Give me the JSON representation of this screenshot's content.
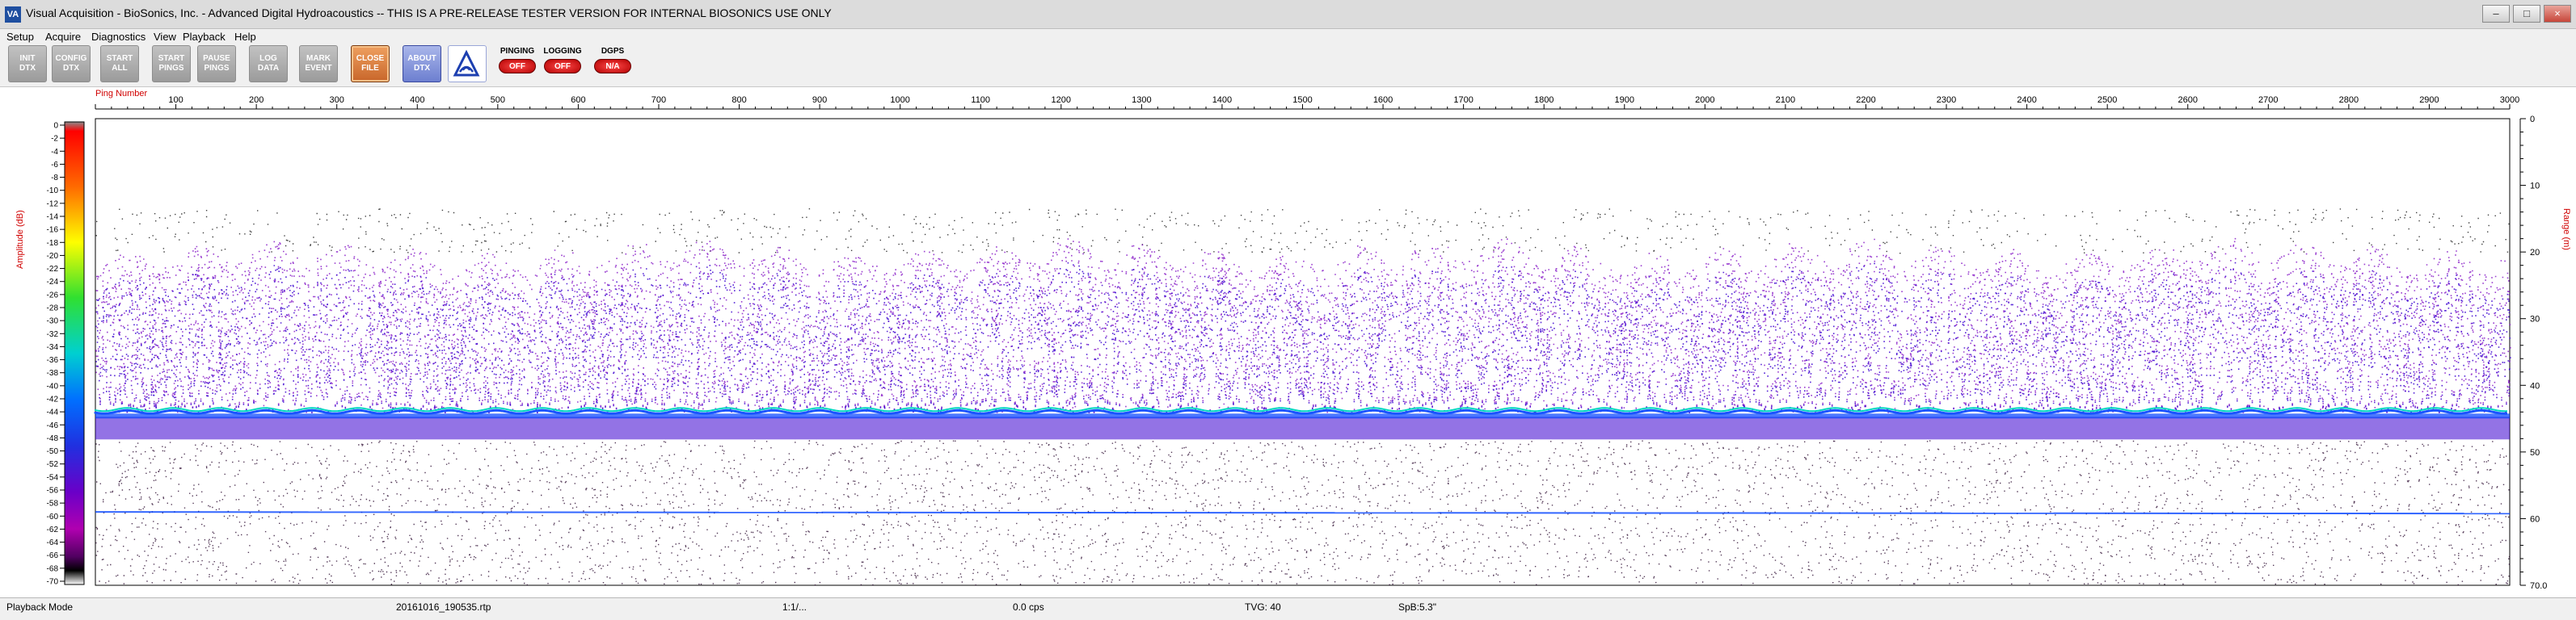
{
  "window": {
    "title": "Visual Acquisition  -  BioSonics, Inc.  -  Advanced Digital Hydroacoustics   -- THIS IS A PRE-RELEASE TESTER VERSION FOR INTERNAL BIOSONICS USE ONLY",
    "icon_text": "VA",
    "minimize": "–",
    "maximize": "□",
    "close": "×"
  },
  "menu": [
    "Setup",
    "Acquire",
    "Diagnostics",
    "View",
    "Playback",
    "Help"
  ],
  "toolbar": {
    "buttons": [
      {
        "line1": "INIT",
        "line2": "DTX",
        "style": "gray"
      },
      {
        "line1": "CONFIG",
        "line2": "DTX",
        "style": "gray"
      },
      {
        "line1": "START",
        "line2": "ALL",
        "style": "gray"
      },
      {
        "line1": "START",
        "line2": "PINGS",
        "style": "gray"
      },
      {
        "line1": "PAUSE",
        "line2": "PINGS",
        "style": "gray"
      },
      {
        "line1": "LOG",
        "line2": "DATA",
        "style": "gray"
      },
      {
        "line1": "MARK",
        "line2": "EVENT",
        "style": "gray"
      },
      {
        "line1": "CLOSE",
        "line2": "FILE",
        "style": "orange"
      },
      {
        "line1": "ABOUT",
        "line2": "DTX",
        "style": "blue"
      }
    ],
    "indicators": [
      {
        "label": "PINGING",
        "value": "OFF"
      },
      {
        "label": "LOGGING",
        "value": "OFF"
      },
      {
        "label": "DGPS",
        "value": "N/A"
      }
    ]
  },
  "echogram": {
    "top_axis_label": "Ping Number",
    "left_axis_label": "Amplitude (dB)",
    "right_axis_label": "Range (m)",
    "ping_ticks": [
      100,
      200,
      300,
      400,
      500,
      600,
      700,
      800,
      900,
      1000,
      1100,
      1200,
      1300,
      1400,
      1500,
      1600,
      1700,
      1800,
      1900,
      2000,
      2100,
      2200,
      2300,
      2400,
      2500,
      2600,
      2700,
      2800,
      2900,
      3000
    ],
    "range_ticks": [
      "0",
      "10",
      "20",
      "30",
      "40",
      "50",
      "60",
      "70.0"
    ],
    "amplitude_ticks": [
      0,
      -2,
      -4,
      -6,
      -8,
      -10,
      -12,
      -14,
      -16,
      -18,
      -20,
      -22,
      -24,
      -26,
      -28,
      -30,
      -32,
      -34,
      -36,
      -38,
      -40,
      -42,
      -44,
      -46,
      -48,
      -50,
      -52,
      -54,
      -56,
      -58,
      -60,
      -62,
      -64,
      -66,
      -68,
      -70
    ],
    "ping_range": [
      0,
      3000
    ],
    "range_limits_m": [
      0,
      70
    ],
    "bottom_depth_m": 44,
    "colorscale": [
      "#ffffff",
      "#fefe00",
      "#b0ff00",
      "#00e040",
      "#00e0c0",
      "#00a0ff",
      "#0040ff",
      "#3a00d0",
      "#7a00c0",
      "#c000c0",
      "#ff0080",
      "#ff0000"
    ]
  },
  "status": {
    "mode": "Playback Mode",
    "file": "20161016_190535.rtp",
    "ratio": "1:1/...",
    "cps": "0.0 cps",
    "tvg": "TVG: 40",
    "spb": "SpB:5.3\""
  }
}
